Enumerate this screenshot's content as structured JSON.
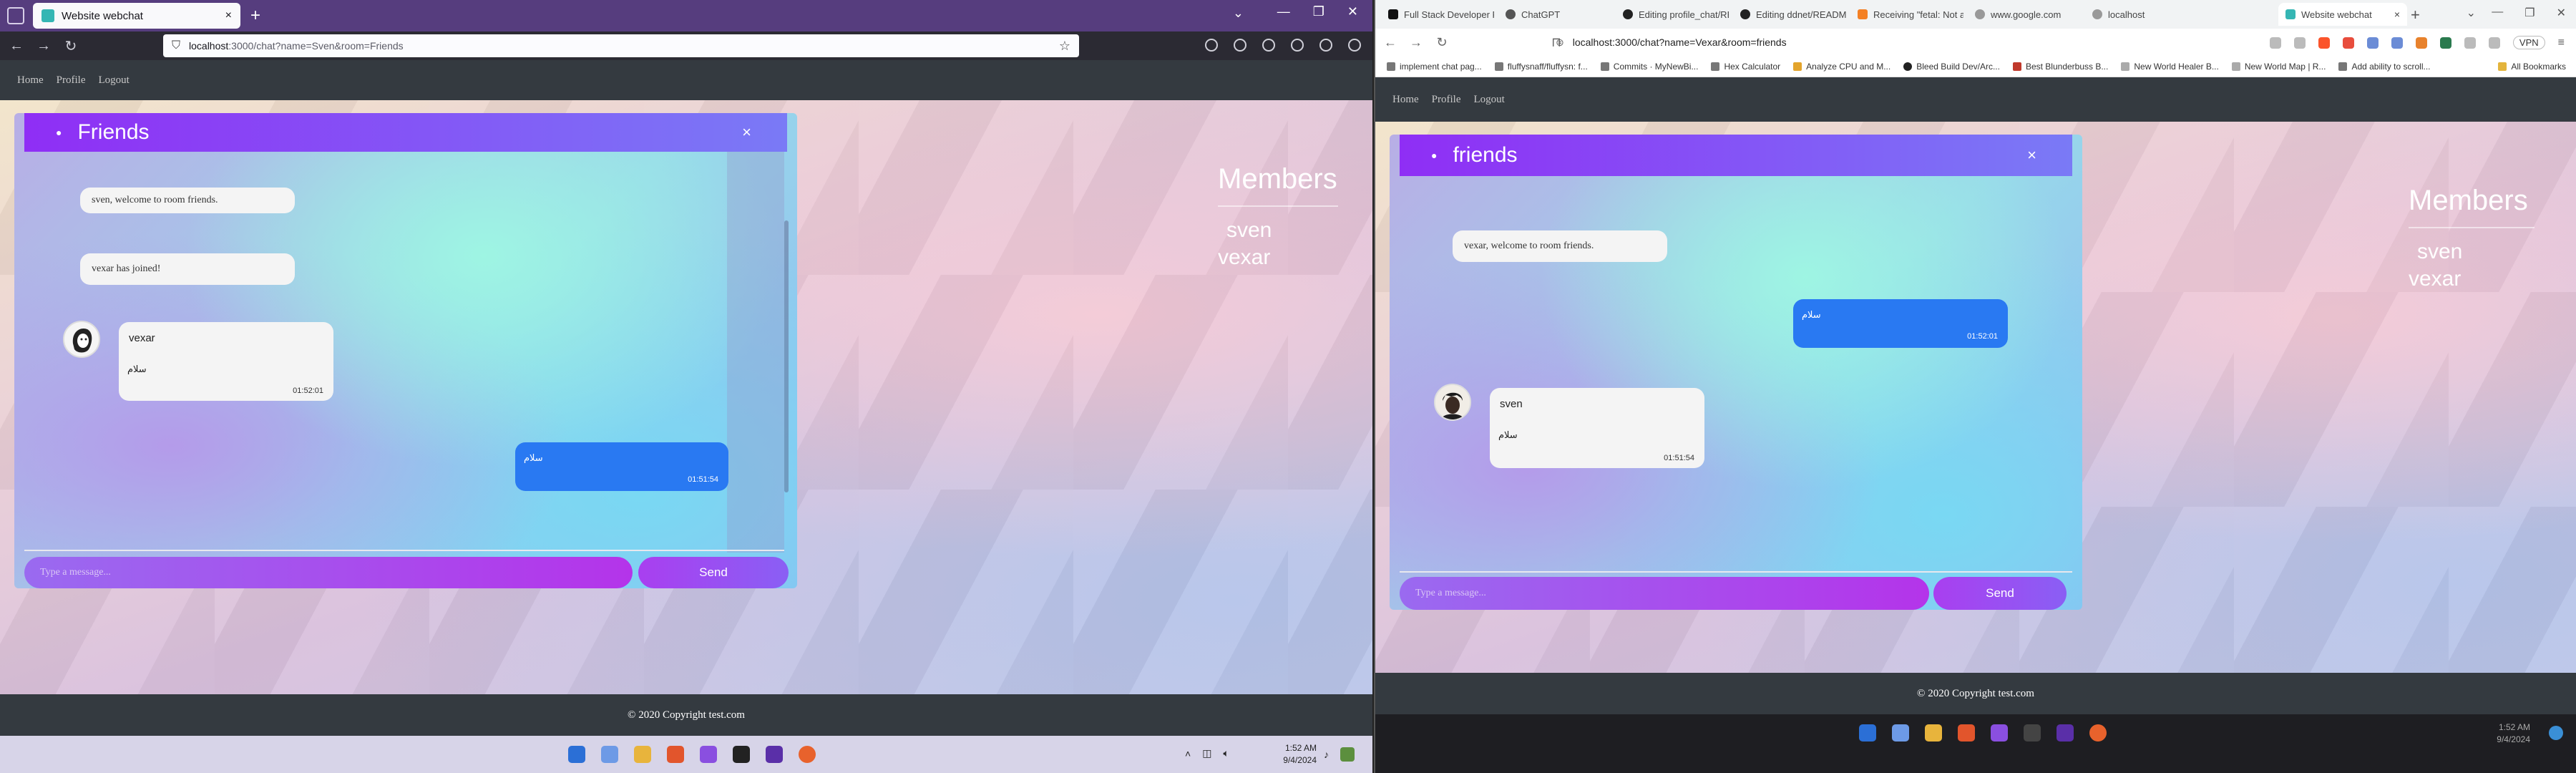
{
  "left_window": {
    "browser": {
      "tab_title": "Website webchat",
      "url_host": "localhost",
      "url_rest": ":3000/chat?name=Sven&room=Friends"
    },
    "site_nav": [
      "Home",
      "Profile",
      "Logout"
    ],
    "chat": {
      "room_title": "Friends",
      "close": "×",
      "messages": [
        {
          "kind": "system",
          "text": "sven, welcome to room friends."
        },
        {
          "kind": "system",
          "text": "vexar has joined!"
        },
        {
          "kind": "other",
          "user": "vexar",
          "text": "سلام",
          "time": "01:52:01",
          "avatar": "avatar-face-icon"
        },
        {
          "kind": "mine",
          "text": "سلام",
          "time": "01:51:54"
        }
      ],
      "input_placeholder": "Type a message...",
      "send_label": "Send"
    },
    "members": {
      "title": "Members",
      "names": [
        "sven",
        "vexar"
      ]
    },
    "footer": "© 2020 Copyright test.com",
    "taskbar": {
      "time": "1:52 AM",
      "date": "9/4/2024"
    }
  },
  "right_window": {
    "browser": {
      "tabs": [
        {
          "title": "Full Stack Developer Ro...",
          "icon": "x-logo-icon"
        },
        {
          "title": "ChatGPT",
          "icon": "chatgpt-icon"
        },
        {
          "title": "Editing profile_chat/RE...",
          "icon": "github-icon"
        },
        {
          "title": "Editing ddnet/READMI...",
          "icon": "github-icon"
        },
        {
          "title": "Receiving \"fetal: Not a g...",
          "icon": "stack-icon"
        },
        {
          "title": "www.google.com",
          "icon": "globe-icon"
        },
        {
          "title": "localhost",
          "icon": "globe-icon"
        },
        {
          "title": "Website webchat",
          "icon": "webchat-icon",
          "active": true
        }
      ],
      "url": "localhost:3000/chat?name=Vexar&room=friends",
      "vpn_label": "VPN",
      "bookmarks": [
        "implement chat pag...",
        "fluffysnaff/fluffysn: f...",
        "Commits · MyNewBi...",
        "Hex Calculator",
        "Analyze CPU and M...",
        "Bleed Build Dev/Arc...",
        "Best Blunderbuss B...",
        "New World Healer B...",
        "New World Map | R...",
        "Add ability to scroll..."
      ],
      "all_bookmarks": "All Bookmarks"
    },
    "site_nav": [
      "Home",
      "Profile",
      "Logout"
    ],
    "chat": {
      "room_title": "friends",
      "close": "×",
      "messages": [
        {
          "kind": "system",
          "text": "vexar, welcome to room friends."
        },
        {
          "kind": "mine",
          "text": "سلام",
          "time": "01:52:01"
        },
        {
          "kind": "other",
          "user": "sven",
          "text": "سلام",
          "time": "01:51:54",
          "avatar": "avatar-dark-icon"
        }
      ],
      "input_placeholder": "Type a message...",
      "send_label": "Send"
    },
    "members": {
      "title": "Members",
      "names": [
        "sven",
        "vexar"
      ]
    },
    "footer": "© 2020 Copyright test.com",
    "taskbar": {
      "time": "1:52 AM",
      "date": "9/4/2024"
    }
  },
  "colors": {
    "ff_tabbar": "#563d7e",
    "site_nav": "#343a40",
    "chat_header_start": "#8f2ef5",
    "chat_header_end": "#7a7af6",
    "my_bubble": "#2979f2",
    "input_start": "#9a6af0",
    "input_end": "#b434ea"
  }
}
